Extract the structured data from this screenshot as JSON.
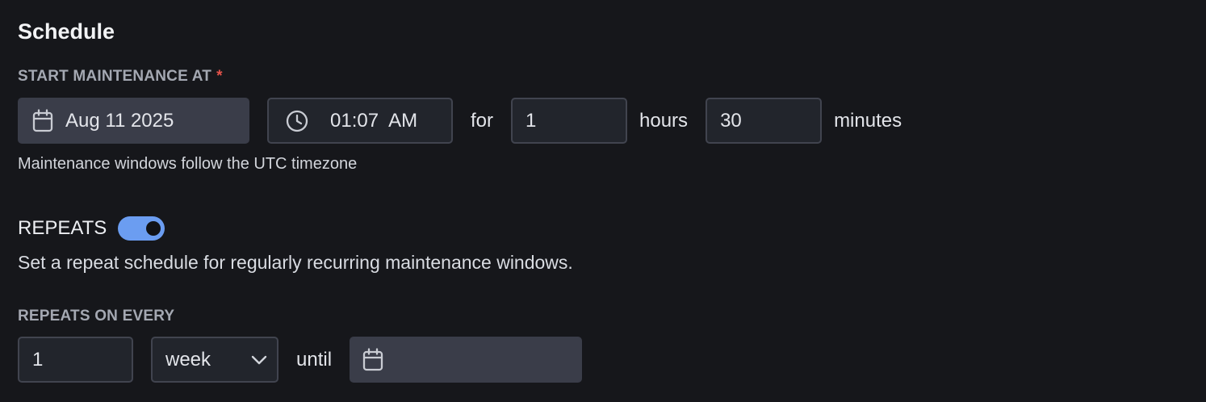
{
  "schedule": {
    "title": "Schedule",
    "start_label": "START MAINTENANCE AT",
    "required_mark": "*",
    "date_value": "Aug 11 2025",
    "time_value": "01:07  AM",
    "for_text": "for",
    "hours_value": "1",
    "hours_text": "hours",
    "minutes_value": "30",
    "minutes_text": "minutes",
    "timezone_note": "Maintenance windows follow the UTC timezone"
  },
  "repeats": {
    "label": "REPEATS",
    "enabled": true,
    "description": "Set a repeat schedule for regularly recurring maintenance windows.",
    "every_label": "REPEATS ON EVERY",
    "interval_value": "1",
    "unit_value": "week",
    "until_text": "until",
    "until_value": ""
  },
  "icons": {
    "date": "calendar-icon",
    "time": "clock-icon",
    "unit_dropdown": "chevron-down-icon",
    "until": "calendar-icon"
  },
  "colors": {
    "background": "#16171b",
    "accent": "#6b9df1",
    "required": "#e5534b",
    "filled_input": "#3a3d49",
    "outline_input": "#41444f"
  }
}
